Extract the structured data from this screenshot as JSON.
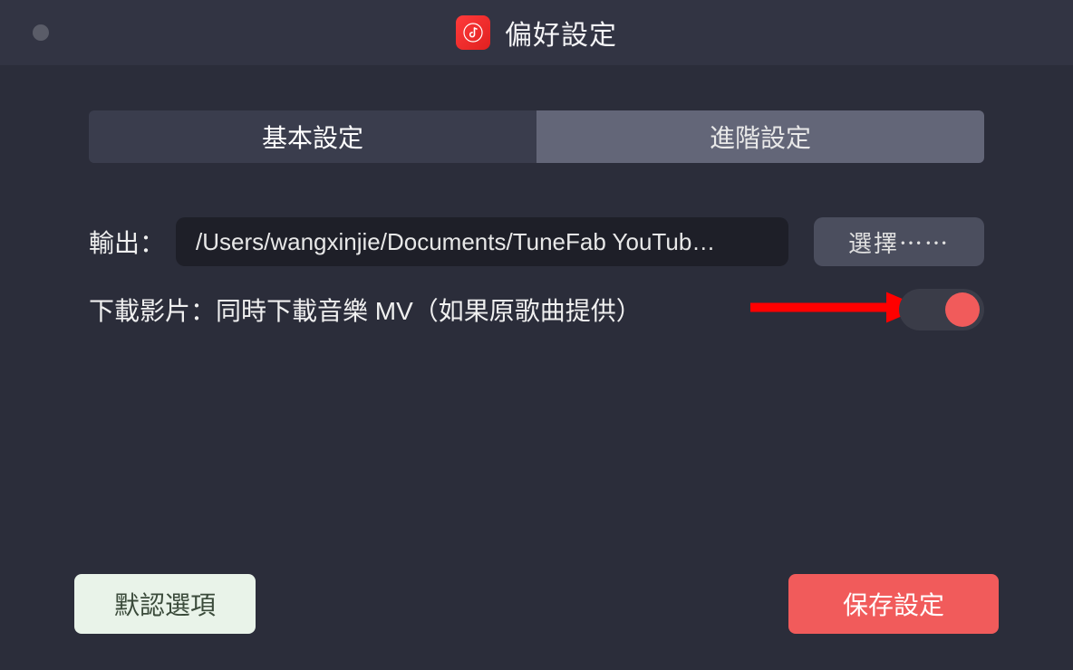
{
  "window": {
    "title": "偏好設定"
  },
  "tabs": {
    "basic": "基本設定",
    "advanced": "進階設定"
  },
  "output": {
    "label": "輸出：",
    "path": "/Users/wangxinjie/Documents/TuneFab YouTub…",
    "choose_button": "選擇⋯⋯"
  },
  "download_video": {
    "label": "下載影片：",
    "description": "同時下載音樂 MV（如果原歌曲提供）",
    "toggle_on": true
  },
  "footer": {
    "default_button": "默認選項",
    "save_button": "保存設定"
  },
  "colors": {
    "accent_red": "#f15b5b",
    "bg_dark": "#2b2d3a",
    "tab_inactive": "#636678"
  }
}
